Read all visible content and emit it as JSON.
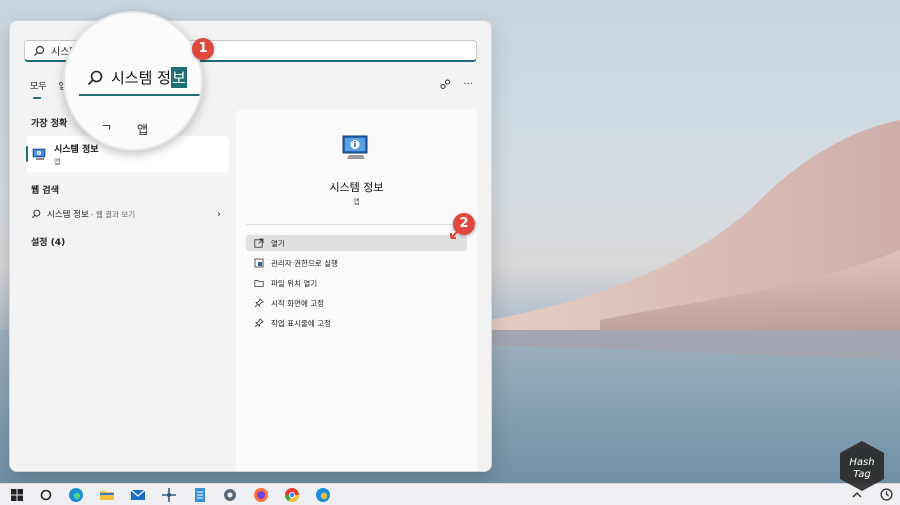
{
  "search": {
    "value": "시스템 정보",
    "placeholder": ""
  },
  "tabs": [
    {
      "label": "모두",
      "active": true
    },
    {
      "label": "앱",
      "active": false
    }
  ],
  "top_icons": [
    "share-icon",
    "more-icon"
  ],
  "more_label": "···",
  "sections": {
    "best_match": "가장 정확",
    "web_search": "웹 검색",
    "settings": "설정 (4)"
  },
  "best_match_item": {
    "title": "시스템 정보",
    "subtitle": "앱"
  },
  "web_search_item": {
    "query": "시스템 정보",
    "suffix": "- 웹 결과 보기",
    "chevron": "›"
  },
  "detail": {
    "title": "시스템 정보",
    "type": "앱",
    "actions": [
      {
        "label": "열기",
        "icon": "open-icon"
      },
      {
        "label": "관리자 권한으로 실행",
        "icon": "shield-icon"
      },
      {
        "label": "파일 위치 열기",
        "icon": "folder-icon"
      },
      {
        "label": "시작 화면에 고정",
        "icon": "pin-icon"
      },
      {
        "label": "작업 표시줄에 고정",
        "icon": "pin-icon"
      }
    ]
  },
  "magnifier": {
    "typed": "시스템 정",
    "selected": "보",
    "letter": "ᄀ",
    "app_label": "앱"
  },
  "badges": [
    "1",
    "2"
  ],
  "watermark": {
    "line1": "Hash",
    "line2": "Tag"
  },
  "colors": {
    "accent": "#1f6e75",
    "badge": "#e0473d",
    "menu_bg": "#f3f3f3"
  }
}
